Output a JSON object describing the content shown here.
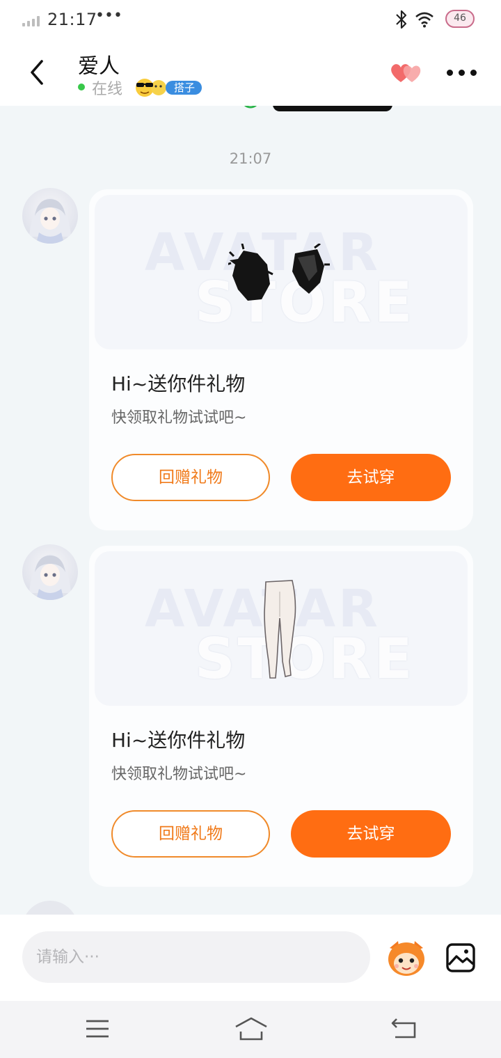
{
  "status_bar": {
    "time": "21:17",
    "dots": "•••",
    "battery": "46"
  },
  "header": {
    "contact_name": "爱人",
    "online_status": "在线",
    "partner_badge": "搭子"
  },
  "chat": {
    "timestamp": "21:07",
    "messages": [
      {
        "image_watermark_top": "AVATAR",
        "image_watermark_bottom": "STORE",
        "gift_item": "cat-ears-icon",
        "title": "Hi~送你件礼物",
        "subtitle": "快领取礼物试试吧~",
        "return_gift_label": "回赠礼物",
        "try_on_label": "去试穿"
      },
      {
        "image_watermark_top": "AVATAR",
        "image_watermark_bottom": "STORE",
        "gift_item": "leggings-icon",
        "title": "Hi~送你件礼物",
        "subtitle": "快领取礼物试试吧~",
        "return_gift_label": "回赠礼物",
        "try_on_label": "去试穿"
      }
    ]
  },
  "input_bar": {
    "placeholder": "请输入···"
  },
  "colors": {
    "accent": "#ff6d12",
    "chat_bg": "#f2f6f8",
    "online": "#38c84a",
    "badge": "#3a8de0"
  }
}
